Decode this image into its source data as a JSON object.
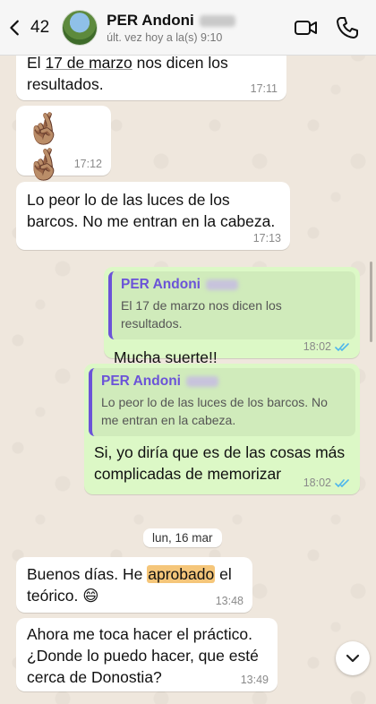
{
  "header": {
    "back_count": "42",
    "contact_name": "PER Andoni",
    "status": "últ. vez hoy a la(s) 9:10"
  },
  "messages": [
    {
      "direction": "in",
      "text_a": "El ",
      "text_underlined": "17 de marzo",
      "text_b": " nos dicen los resultados.",
      "time": "17:11"
    },
    {
      "direction": "in",
      "emoji": "🤞🏽 🤞🏽",
      "time": "17:12"
    },
    {
      "direction": "in",
      "text": "Lo peor lo de las luces de los barcos. No me entran en la cabeza.",
      "time": "17:13"
    },
    {
      "direction": "out",
      "quote_name": "PER Andoni",
      "quote_text": "El 17 de marzo nos dicen los resultados.",
      "text": "Mucha suerte!!",
      "time": "18:02"
    },
    {
      "direction": "out",
      "quote_name": "PER Andoni",
      "quote_text": "Lo peor lo de las luces de los barcos. No me entran en la cabeza.",
      "text": "Si, yo diría que es de las cosas más complicadas de memorizar",
      "time": "18:02"
    },
    {
      "direction": "in",
      "text_a": "Buenos días.  He ",
      "text_highlight": "aprobado",
      "text_b": " el teórico. 😄",
      "time": "13:48"
    },
    {
      "direction": "in",
      "text": "Ahora me toca hacer el práctico. ¿Donde lo puedo hacer, que esté cerca de Donostia?",
      "time": "13:49"
    }
  ],
  "date_separator": "lun, 16 mar",
  "colors": {
    "incoming_bubble": "#ffffff",
    "outgoing_bubble": "#dcf8c6",
    "quote_accent": "#6b53d8",
    "read_ticks": "#4fb6ec",
    "highlight": "#f5c67a"
  },
  "icons": {
    "back": "chevron-left-icon",
    "video": "video-camera-icon",
    "call": "phone-icon",
    "scroll": "chevron-down-icon"
  }
}
